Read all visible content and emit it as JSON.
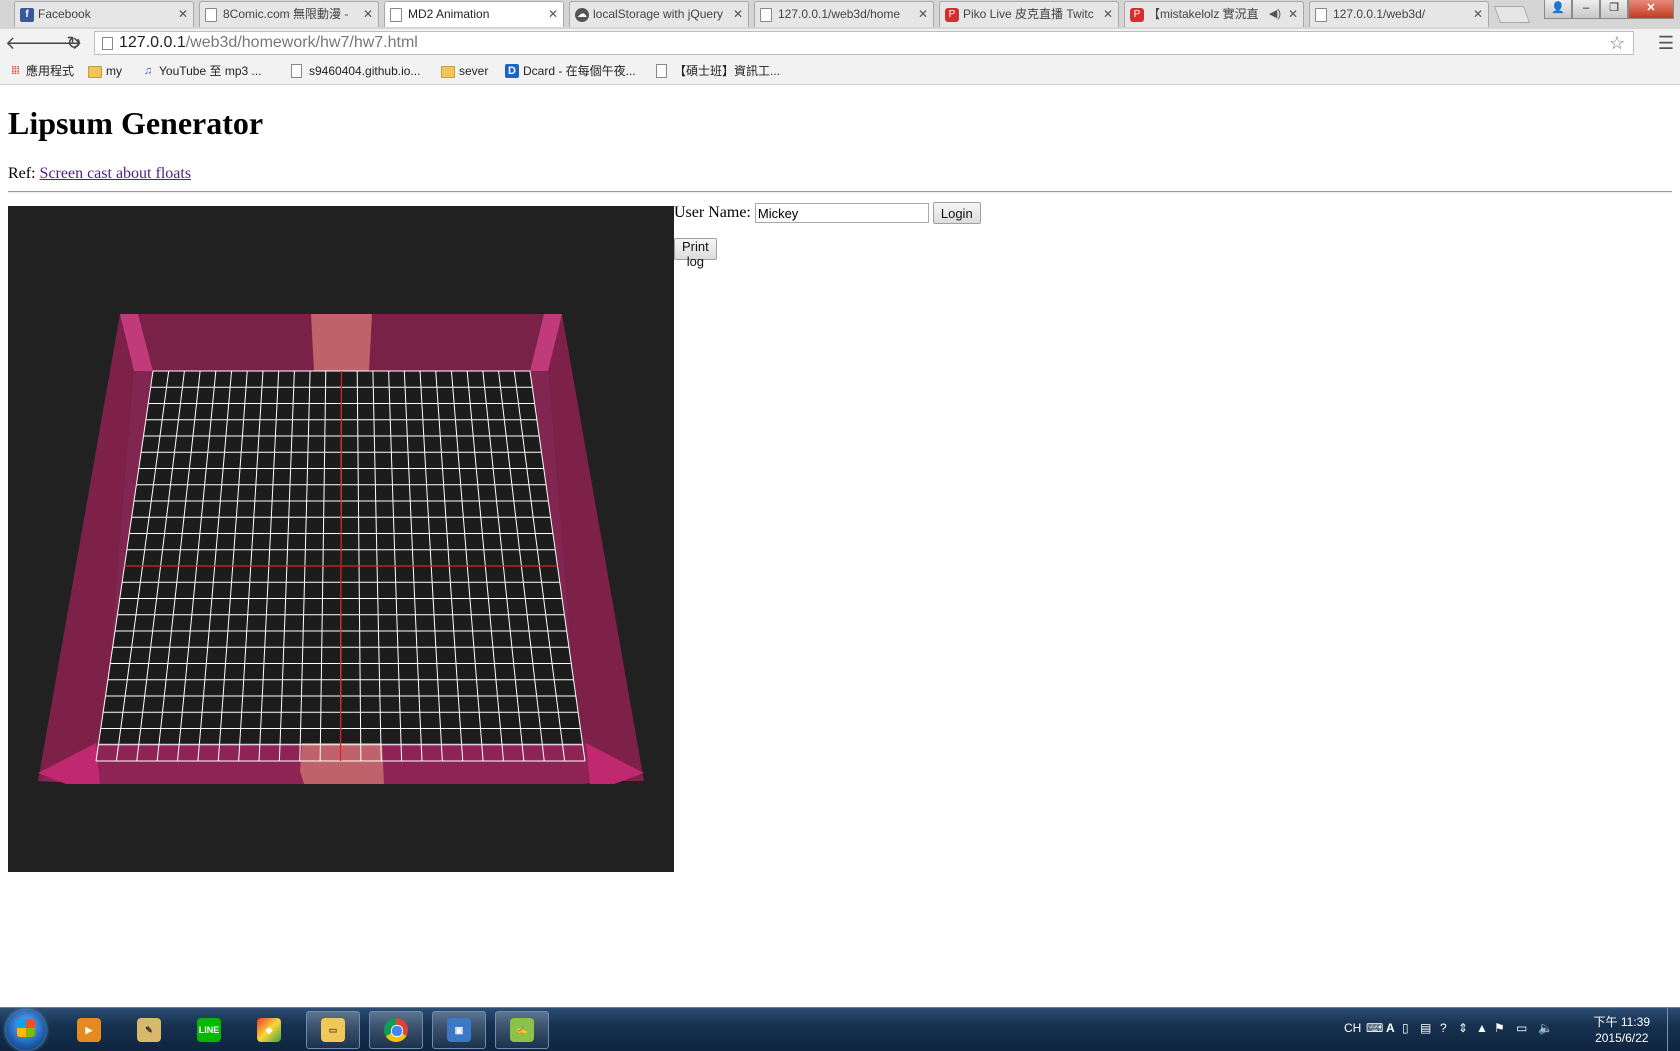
{
  "browser": {
    "tabs": [
      {
        "title": "Facebook",
        "favicon": "facebook-icon"
      },
      {
        "title": "8Comic.com 無限動漫 -",
        "favicon": "page-icon"
      },
      {
        "title": "MD2 Animation",
        "favicon": "page-icon",
        "active": true
      },
      {
        "title": "localStorage with jQuery",
        "favicon": "cloud-icon"
      },
      {
        "title": "127.0.0.1/web3d/home",
        "favicon": "page-icon"
      },
      {
        "title": "Piko Live 皮克直播 Twitc",
        "favicon": "piko-icon"
      },
      {
        "title": "【mistakelolz 實況直",
        "favicon": "piko-icon"
      },
      {
        "title": "127.0.0.1/web3d/",
        "favicon": "page-icon"
      }
    ],
    "url_host": "127.0.0.1",
    "url_path": "/web3d/homework/hw7/hw7.html",
    "bookmarks": [
      {
        "label": "應用程式",
        "icon": "apps-icon"
      },
      {
        "label": "my",
        "icon": "folder-icon"
      },
      {
        "label": "YouTube 至 mp3 ...",
        "icon": "youtube-mp3-icon"
      },
      {
        "label": "s9460404.github.io...",
        "icon": "page-icon"
      },
      {
        "label": "sever",
        "icon": "folder-icon"
      },
      {
        "label": "Dcard - 在每個午夜...",
        "icon": "dcard-icon"
      },
      {
        "label": "【碩士班】資訊工...",
        "icon": "page-icon"
      }
    ]
  },
  "page": {
    "title": "Lipsum Generator",
    "ref_prefix": "Ref:",
    "ref_link": "Screen cast about floats",
    "username_label": "User Name:",
    "username_value": "Mickey",
    "login_label": "Login",
    "printlog_label": "Print log"
  },
  "scene": {
    "background": "#212121",
    "wall_color": "#7a2148",
    "wall_highlight": "#a8316a",
    "opening_color": "#c0626a",
    "grid_color": "#ffffff",
    "axis_color": "#e02020",
    "grid_divisions": 24
  },
  "taskbar": {
    "tray_lang": "CH",
    "time": "下午 11:39",
    "date": "2015/6/22"
  }
}
